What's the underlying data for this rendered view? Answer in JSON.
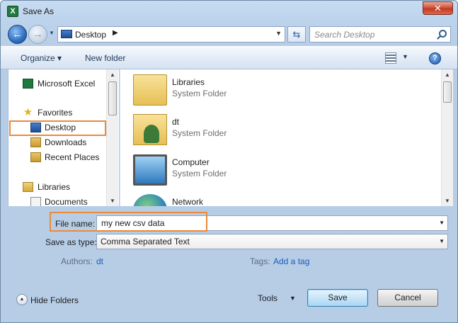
{
  "window": {
    "title": "Save As",
    "app_icon": "excel-icon"
  },
  "navigation": {
    "breadcrumb": "Desktop",
    "search_placeholder": "Search Desktop"
  },
  "toolbar": {
    "organize_label": "Organize",
    "new_folder_label": "New folder"
  },
  "nav_pane": {
    "items": [
      {
        "label": "Microsoft Excel",
        "icon": "excel-icon"
      },
      {
        "label": "Favorites",
        "icon": "star-icon"
      },
      {
        "label": "Desktop",
        "icon": "desktop-icon",
        "selected": true
      },
      {
        "label": "Downloads",
        "icon": "downloads-icon"
      },
      {
        "label": "Recent Places",
        "icon": "recent-places-icon"
      },
      {
        "label": "Libraries",
        "icon": "libraries-icon"
      },
      {
        "label": "Documents",
        "icon": "documents-icon"
      }
    ]
  },
  "files": [
    {
      "name": "Libraries",
      "type": "System Folder",
      "icon": "libraries-folder-icon"
    },
    {
      "name": "dt",
      "type": "System Folder",
      "icon": "user-folder-icon"
    },
    {
      "name": "Computer",
      "type": "System Folder",
      "icon": "computer-icon"
    },
    {
      "name": "Network",
      "type": "",
      "icon": "network-icon"
    }
  ],
  "form": {
    "file_name_label": "File name:",
    "file_name_value": "my new csv data",
    "save_as_type_label": "Save as type:",
    "save_as_type_value": "Comma Separated Text",
    "authors_label": "Authors:",
    "authors_value": "dt",
    "tags_label": "Tags:",
    "tags_value": "Add a tag"
  },
  "footer": {
    "hide_folders_label": "Hide Folders",
    "tools_label": "Tools",
    "save_label": "Save",
    "cancel_label": "Cancel"
  },
  "colors": {
    "highlight": "#ea8a3a",
    "link": "#1c5cb8",
    "close": "#c23a22"
  }
}
